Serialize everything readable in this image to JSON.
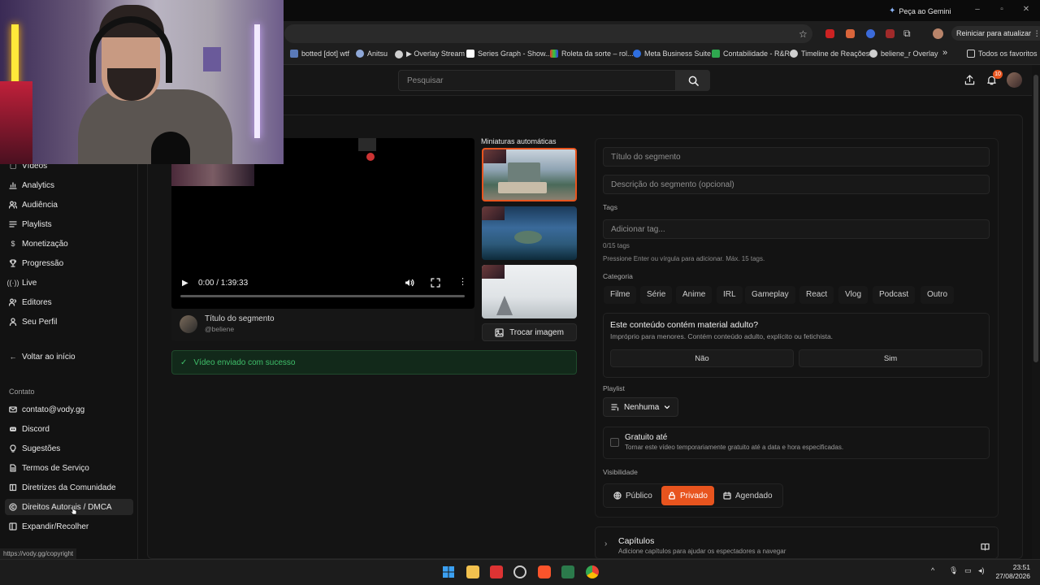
{
  "browser": {
    "gemini_label": "Peça ao Gemini",
    "restart_label": "Reiniciar para atualizar",
    "bookmarks": [
      "botted [dot] wtf",
      "Anitsu",
      "▶ Overlay Stream",
      "Series Graph - Show...",
      "Roleta da sorte – rol...",
      "Meta Business Suite",
      "Contabilidade - R&R",
      "Timeline de Reações",
      "beliene_r Overlay"
    ],
    "all_favorites": "Todos os favoritos",
    "more_bookmarks": "»",
    "status_url": "https://vody.gg/copyright"
  },
  "header": {
    "search_placeholder": "Pesquisar",
    "notification_count": "10"
  },
  "sidebar": {
    "items": [
      {
        "label": "Vídeos",
        "icon": "video-icon"
      },
      {
        "label": "Analytics",
        "icon": "chart-icon"
      },
      {
        "label": "Audiência",
        "icon": "users-icon"
      },
      {
        "label": "Playlists",
        "icon": "list-icon"
      },
      {
        "label": "Monetização",
        "icon": "dollar-icon"
      },
      {
        "label": "Progressão",
        "icon": "trophy-icon"
      },
      {
        "label": "Live",
        "icon": "broadcast-icon"
      },
      {
        "label": "Editores",
        "icon": "users-edit-icon"
      },
      {
        "label": "Seu Perfil",
        "icon": "user-icon"
      }
    ],
    "back_label": "Voltar ao início",
    "contact_heading": "Contato",
    "contact_items": [
      {
        "label": "contato@vody.gg",
        "icon": "mail-icon"
      },
      {
        "label": "Discord",
        "icon": "discord-icon"
      },
      {
        "label": "Sugestões",
        "icon": "lightbulb-icon"
      },
      {
        "label": "Termos de Serviço",
        "icon": "document-icon"
      },
      {
        "label": "Diretrizes da Comunidade",
        "icon": "book-icon"
      },
      {
        "label": "Direitos Autorais / DMCA",
        "icon": "copyright-icon"
      },
      {
        "label": "Expandir/Recolher",
        "icon": "panel-icon"
      }
    ]
  },
  "player": {
    "time": "0:00 / 1:39:33",
    "segment_title": "Título do segmento",
    "username": "@beliene",
    "progress": 0
  },
  "upload_status": "Vídeo enviado com sucesso",
  "thumbnails": {
    "label": "Miniaturas automáticas",
    "swap_label": "Trocar imagem",
    "selected_index": 0
  },
  "form": {
    "title_placeholder": "Título do segmento",
    "description_placeholder": "Descrição do segmento (opcional)",
    "tags_label": "Tags",
    "tags_placeholder": "Adicionar tag...",
    "tags_count": "0/15 tags",
    "tags_hint": "Pressione Enter ou vírgula para adicionar. Máx. 15 tags.",
    "category_label": "Categoria",
    "categories": [
      "Filme",
      "Série",
      "Anime",
      "IRL",
      "Gameplay",
      "React",
      "Vlog",
      "Podcast",
      "Outro"
    ],
    "adult_question": "Este conteúdo contém material adulto?",
    "adult_hint": "Impróprio para menores. Contém conteúdo adulto, explícito ou fetichista.",
    "adult_no": "Não",
    "adult_yes": "Sim",
    "playlist_label": "Playlist",
    "playlist_value": "Nenhuma",
    "free_title": "Gratuito até",
    "free_hint": "Tornar este vídeo temporariamente gratuito até a data e hora especificadas.",
    "visibility_label": "Visibilidade",
    "visibility_options": [
      "Público",
      "Privado",
      "Agendado"
    ],
    "visibility_selected": "Privado",
    "chapters_title": "Capítulos",
    "chapters_hint": "Adicione capítulos para ajudar os espectadores a navegar"
  },
  "taskbar": {
    "time": "23:51",
    "date": "27/08/2026"
  },
  "colors": {
    "accent": "#e8541e",
    "success": "#3fbf6a"
  }
}
